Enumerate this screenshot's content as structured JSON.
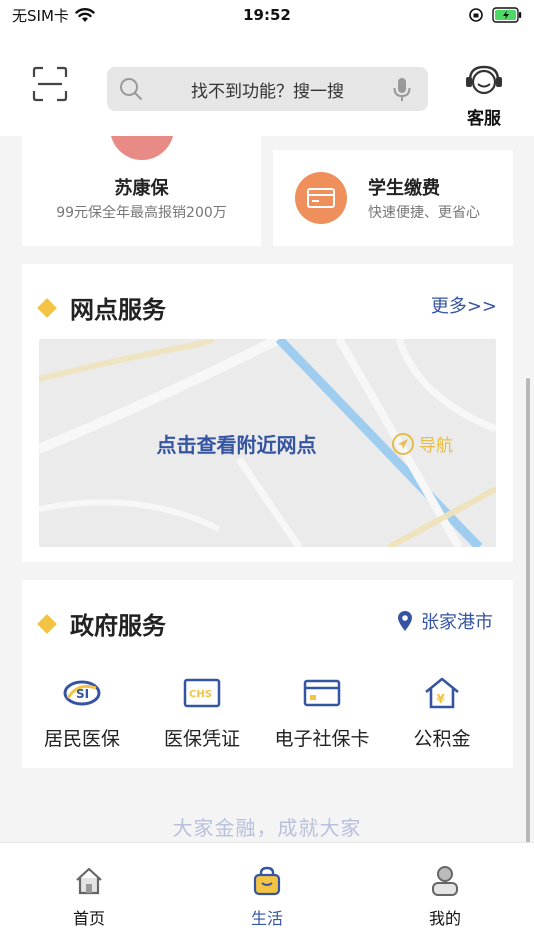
{
  "status_bar": {
    "carrier": "无SIM卡",
    "time": "19:52"
  },
  "header": {
    "search_placeholder": "找不到功能？搜一搜",
    "customer_service": "客服"
  },
  "cards": {
    "sukang": {
      "title": "苏康保",
      "subtitle": "99元保全年最高报销200万"
    },
    "student": {
      "title": "学生缴费",
      "subtitle": "快速便捷、更省心"
    }
  },
  "branch": {
    "title": "网点服务",
    "more": "更多>>",
    "map_prompt": "点击查看附近网点",
    "nav": "导航"
  },
  "gov": {
    "title": "政府服务",
    "location": "张家港市",
    "items": [
      {
        "label": "居民医保",
        "icon": "medical-insurance-icon"
      },
      {
        "label": "医保凭证",
        "icon": "chs-voucher-icon"
      },
      {
        "label": "电子社保卡",
        "icon": "social-security-card-icon"
      },
      {
        "label": "公积金",
        "icon": "housing-fund-icon"
      }
    ]
  },
  "slogan": "大家金融，成就大家",
  "tabs": [
    {
      "label": "首页",
      "icon": "home-icon",
      "active": false
    },
    {
      "label": "生活",
      "icon": "life-bag-icon",
      "active": true
    },
    {
      "label": "我的",
      "icon": "profile-icon",
      "active": false
    }
  ],
  "colors": {
    "accent_blue": "#3554a2",
    "diamond_yellow": "#f3c443",
    "student_orange": "#ee8f5c",
    "sukang_red": "#e88a86"
  }
}
